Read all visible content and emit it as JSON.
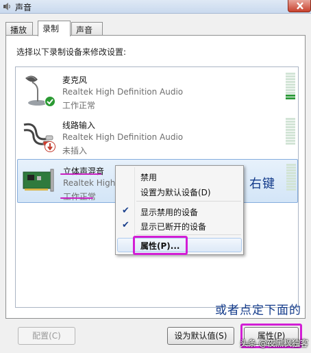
{
  "window": {
    "title": "声音"
  },
  "tabs": [
    {
      "label": "播放"
    },
    {
      "label": "录制"
    },
    {
      "label": "声音"
    }
  ],
  "instruction": "选择以下录制设备来修改设置:",
  "devices": [
    {
      "name": "麦克风",
      "driver": "Realtek High Definition Audio",
      "status": "工作正常",
      "icon": "microphone-icon",
      "badge": "green-check",
      "level": 2
    },
    {
      "name": "线路输入",
      "driver": "Realtek High Definition Audio",
      "status": "未插入",
      "icon": "line-in-cable-icon",
      "badge": "red-down-arrow",
      "level": 0
    },
    {
      "name": "立体声混音",
      "driver": "Realtek High",
      "status": "工作正常",
      "icon": "sound-card-icon",
      "badge": "",
      "level": 0
    }
  ],
  "context_menu": {
    "items": [
      {
        "label": "禁用",
        "checked": false
      },
      {
        "label": "设置为默认设备(D)",
        "checked": false
      },
      {
        "label": "显示禁用的设备",
        "checked": true
      },
      {
        "label": "显示已断开的设备",
        "checked": true
      },
      {
        "label": "属性(P)...",
        "checked": false,
        "bold": true
      }
    ]
  },
  "annotations": {
    "right_click": "右键",
    "or_click_below": "或者点定下面的"
  },
  "buttons": {
    "configure": "配置(C)",
    "set_default": "设为默认值(S)",
    "properties": "属性(P)"
  },
  "watermark": "头条 @夜黑枫独客",
  "colors": {
    "highlight_pink": "#d21ed5",
    "handwriting": "#123a8a"
  }
}
